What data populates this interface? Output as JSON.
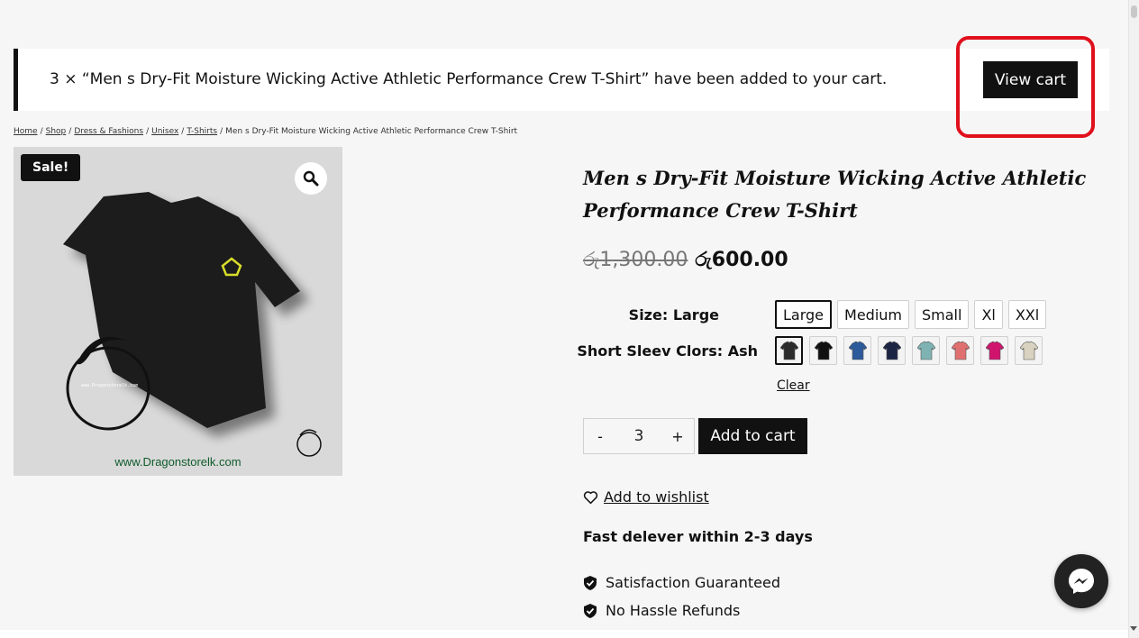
{
  "notice": {
    "message": "3 × “Men s Dry-Fit Moisture Wicking Active Athletic Performance Crew T-Shirt” have been added to your cart.",
    "view_cart_label": "View cart"
  },
  "breadcrumb": {
    "items": [
      "Home",
      "Shop",
      "Dress & Fashions",
      "Unisex",
      "T-Shirts"
    ],
    "current": "Men s Dry-Fit Moisture Wicking Active Athletic Performance Crew T-Shirt"
  },
  "gallery": {
    "sale_badge": "Sale!",
    "zoom_icon": "magnifier-icon",
    "image_watermark": "www.Dragonstorelk.com"
  },
  "product": {
    "title": "Men s Dry-Fit Moisture Wicking Active Athletic Performance Crew T-Shirt",
    "old_price": "රු1,300.00",
    "new_price": "රු600.00"
  },
  "variations": {
    "size_label": "Size: Large",
    "sizes": [
      "Large",
      "Medium",
      "Small",
      "Xl",
      "XXl"
    ],
    "selected_size": "Large",
    "color_label": "Short Sleev Clors: Ash",
    "colors": [
      "#2b2b2b",
      "#111111",
      "#2d5a9a",
      "#1d2545",
      "#7fb3b3",
      "#e07070",
      "#d0146e",
      "#d9d2c0"
    ],
    "clear_label": "Clear"
  },
  "cart": {
    "minus_label": "-",
    "quantity": "3",
    "plus_label": "+",
    "add_label": "Add to cart"
  },
  "wishlist": {
    "label": " Add to wishlist"
  },
  "delivery": "Fast delever within 2-3 days",
  "features": [
    "Satisfaction Guaranteed",
    "No Hassle Refunds"
  ],
  "colors": {
    "highlight": "#e0101c",
    "primary": "#111111"
  }
}
